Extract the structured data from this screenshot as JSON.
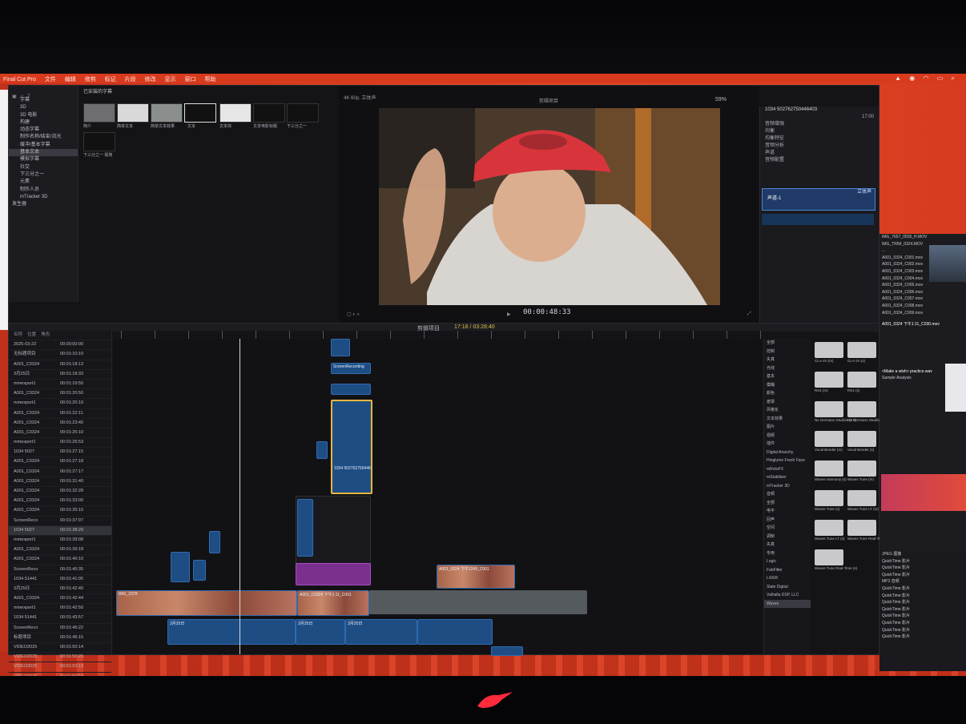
{
  "menubar": {
    "items": [
      "Final Cut Pro",
      "文件",
      "编辑",
      "修剪",
      "标记",
      "片段",
      "修改",
      "显示",
      "窗口",
      "帮助"
    ]
  },
  "library": {
    "items": [
      "字幕",
      "3D",
      "3D 电影",
      "构建",
      "动态字幕",
      "制作名称/结束/流光",
      "缓冲/基本字幕",
      "基本文本",
      "模拟字幕",
      "社交",
      "下三分之一",
      "元素",
      "制作人员",
      "mTracker 3D"
    ],
    "bottom": "发生器"
  },
  "titles": {
    "header": "已安装的字幕",
    "thumbs": [
      "简介",
      "简单文本",
      "简单文本效果",
      "文本",
      "文本块",
      "文本电影标题",
      "下三分之一",
      "下三分之一 极简"
    ]
  },
  "viewer": {
    "header": "4K 60p, 立体声",
    "title": "剪辑项目",
    "timecode": "00:00:48:33",
    "zoom": "59%"
  },
  "inspector": {
    "clip_id": "1034 502762750446403",
    "duration": "17:00",
    "rows": [
      "音频增强",
      "均衡",
      "均衡特征",
      "音频分析",
      "声道",
      "音频配置"
    ],
    "selected": "声道-1",
    "sublabel": "立体声"
  },
  "timeline": {
    "title": "剪辑项目",
    "timecode": "17:18 / 03:28:40"
  },
  "index": {
    "columns": [
      "名称",
      "位置",
      "角色"
    ],
    "rows": [
      [
        "2025-03-22",
        "00:00:00:00"
      ],
      [
        "无标题项目",
        "00:01:10:10"
      ],
      [
        "A001_C0324",
        "00:01:18:13"
      ],
      [
        "3月25日",
        "00:01:18:33"
      ],
      [
        "mmexport1",
        "00:01:19:55"
      ],
      [
        "A001_C0324",
        "00:01:20:50"
      ],
      [
        "mmexport1",
        "00:01:20:10"
      ],
      [
        "A001_C0324",
        "00:01:22:11"
      ],
      [
        "A001_C0324",
        "00:01:23:45"
      ],
      [
        "A001_C0324",
        "00:01:25:10"
      ],
      [
        "mmexport1",
        "00:01:26:53"
      ],
      [
        "1034 5027",
        "00:01:27:15"
      ],
      [
        "A001_C0324",
        "00:01:27:18"
      ],
      [
        "A001_C0324",
        "00:01:27:17"
      ],
      [
        "A001_C0324",
        "00:01:31:40"
      ],
      [
        "A001_C0324",
        "00:01:32:28"
      ],
      [
        "A001_C0324",
        "00:01:33:00"
      ],
      [
        "A001_C0324",
        "00:01:35:10"
      ],
      [
        "ScreenReco",
        "00:01:37:07"
      ],
      [
        "1034 5027",
        "00:01:38:29"
      ],
      [
        "mmexport1",
        "00:01:39:08"
      ],
      [
        "A001_C0324",
        "00:01:39:18"
      ],
      [
        "A001_C0324",
        "00:01:40:10"
      ],
      [
        "ScreenReco",
        "00:01:40:35"
      ],
      [
        "1034 51441",
        "00:01:41:05"
      ],
      [
        "3月25日",
        "00:01:42:40"
      ],
      [
        "A001_C0324",
        "00:01:42:44"
      ],
      [
        "mmexport1",
        "00:01:42:50"
      ],
      [
        "1034 51441",
        "00:01:43:57"
      ],
      [
        "ScreenReco",
        "00:01:45:22"
      ],
      [
        "标题项目",
        "00:01:45:15"
      ],
      [
        "VIDEO2025",
        "00:01:50:14"
      ],
      [
        "VIDEO2025",
        "00:01:50:20"
      ],
      [
        "VIDEO2025",
        "00:01:53:13"
      ],
      [
        "VIDEO2025",
        "00:01:55:19"
      ],
      [
        "3月25日",
        "00:02:12:20"
      ]
    ]
  },
  "clips": {
    "main1": "IMG_2378",
    "main2": "A001_C0324 下午1:11_C001",
    "right1": "A001_0324 下午1249_C001",
    "audio1": "3月25日",
    "audio2": "3月25日",
    "audio3": "3月25日",
    "screen": "ScreenRecording",
    "title1": "1034 502762750446"
  },
  "effects": {
    "categories": [
      "全部",
      "控制",
      "失真",
      "光线",
      "基本",
      "模糊",
      "颜色",
      "遮罩",
      "风格化",
      "文本效果",
      "图片",
      "视频",
      "插件",
      "Digital Anarchy",
      "Hinglume Fresh Face",
      "mRotoFX",
      "mStabilizer",
      "mTracker 3D",
      "音频",
      "全部",
      "电平",
      "回声",
      "空间",
      "调制",
      "失真",
      "专用",
      "Logic",
      "FabFilter",
      "LiVER",
      "Slate Digital",
      "Valhalla DSP, LLC",
      "Waves"
    ],
    "selected": "Waves",
    "items": [
      "CLA-2A (m)",
      "CLA-2A (s)",
      "RS1 (m)",
      "RS1 (s)",
      "Nx Germano Studios (2-s)",
      "Nx Germano Studios (s)",
      "Vocal Bender (m)",
      "Vocal Bender (s)",
      "Waves Harmony (s)",
      "Waves Tune (m)",
      "Waves Tune (s)",
      "Waves Tune LT (m)",
      "Waves Tune LT (s)",
      "Waves Tune Real-Time (m)",
      "Waves Tune Real-Time (s)"
    ]
  },
  "finder": {
    "rows": [
      "IMG_7657_0505_H.MOV",
      "IMG_TRIM_0324.MOV",
      "...",
      "A001_0324_C001.mov",
      "A001_0324_C002.mov",
      "A001_0324_C003.mov",
      "A001_0324_C004.mov",
      "A001_0324_C005.mov",
      "A001_0324_C006.mov",
      "A001_0324_C007.mov",
      "A001_0324_C008.mov",
      "A001_0324_C009.mov"
    ],
    "caption1": "A001_0324 下午1:11_C030.mov",
    "caption2": "<Make a wish> practice.wav",
    "caption3": "Sample Analysis",
    "bottom_rows": [
      "JPEG 图像",
      "QuickTime 影片",
      "QuickTime 影片",
      "QuickTime 影片",
      "MP3 音频",
      "QuickTime 影片",
      "QuickTime 影片",
      "QuickTime 影片",
      "QuickTime 影片",
      "QuickTime 影片",
      "QuickTime 影片",
      "QuickTime 影片",
      "QuickTime 影片"
    ]
  }
}
